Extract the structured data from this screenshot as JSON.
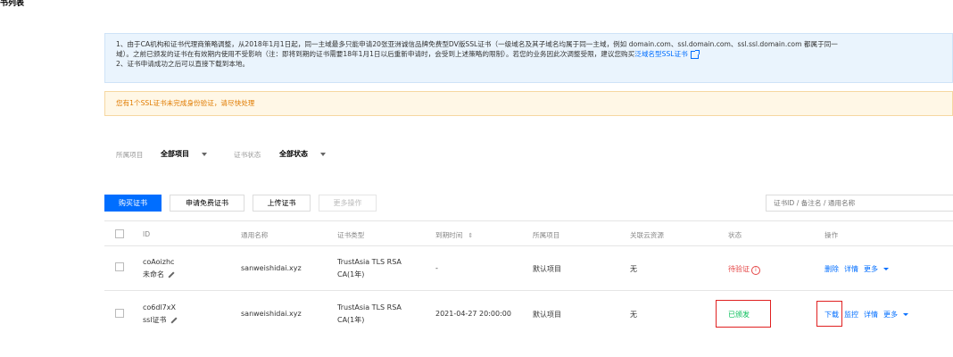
{
  "page_title": "书列表",
  "notice": {
    "line1": "1、由于CA机构和证书代理商策略调整，从2018年1月1日起，同一主域最多只能申请20张亚洲诚信品牌免费型DV版SSL证书（一级域名及其子域名均属于同一主域，例如 domain.com、ssl.domain.com、ssl.ssl.domain.com 都属于同一",
    "line2_pre": "域）。之前已颁发的证书在有效期内使用不受影响（注：即将到期的证书需要18年1月1日以后重新申请时，会受到上述策略的限制）。若您的业务因此次调整受限，建议您购买",
    "line2_link": "泛域名型SSL证书",
    "line3": "2、证书申请成功之后可以直接下载到本地。"
  },
  "warning": "您有1个SSL证书未完成身份验证，请尽快处理",
  "filters": {
    "project_label": "所属项目",
    "project_value": "全部项目",
    "status_label": "证书状态",
    "status_value": "全部状态"
  },
  "toolbar": {
    "buy": "购买证书",
    "apply_free": "申请免费证书",
    "upload": "上传证书",
    "more": "更多操作",
    "search_placeholder": "证书ID / 备注名 / 通用名称"
  },
  "table": {
    "headers": {
      "id": "ID",
      "common_name": "通用名称",
      "cert_type": "证书类型",
      "expire": "到期时间",
      "project": "所属项目",
      "resource": "关联云资源",
      "status": "状态",
      "ops": "操作"
    },
    "sort_icon": "⇕",
    "rows": [
      {
        "id": "coAoizhc",
        "remark": "未命名",
        "common_name": "sanweishidai.xyz",
        "type_line1": "TrustAsia TLS RSA",
        "type_line2": "CA(1年)",
        "expire": "-",
        "project": "默认项目",
        "resource": "无",
        "status": "待验证",
        "status_color": "#e54545",
        "ops": [
          "删除",
          "详情",
          "更多"
        ]
      },
      {
        "id": "co6dl7xX",
        "remark": "ssl证书",
        "common_name": "sanweishidai.xyz",
        "type_line1": "TrustAsia TLS RSA",
        "type_line2": "CA(1年)",
        "expire": "2021-04-27 20:00:00",
        "project": "默认项目",
        "resource": "无",
        "status": "已颁发",
        "status_color": "#0abf5b",
        "ops": [
          "下载",
          "监控",
          "详情",
          "更多"
        ]
      }
    ]
  },
  "colors": {
    "accent": "#006eff",
    "warning": "#e07b00",
    "danger": "#e54545",
    "success": "#0abf5b",
    "highlight_box": "#e02020"
  }
}
